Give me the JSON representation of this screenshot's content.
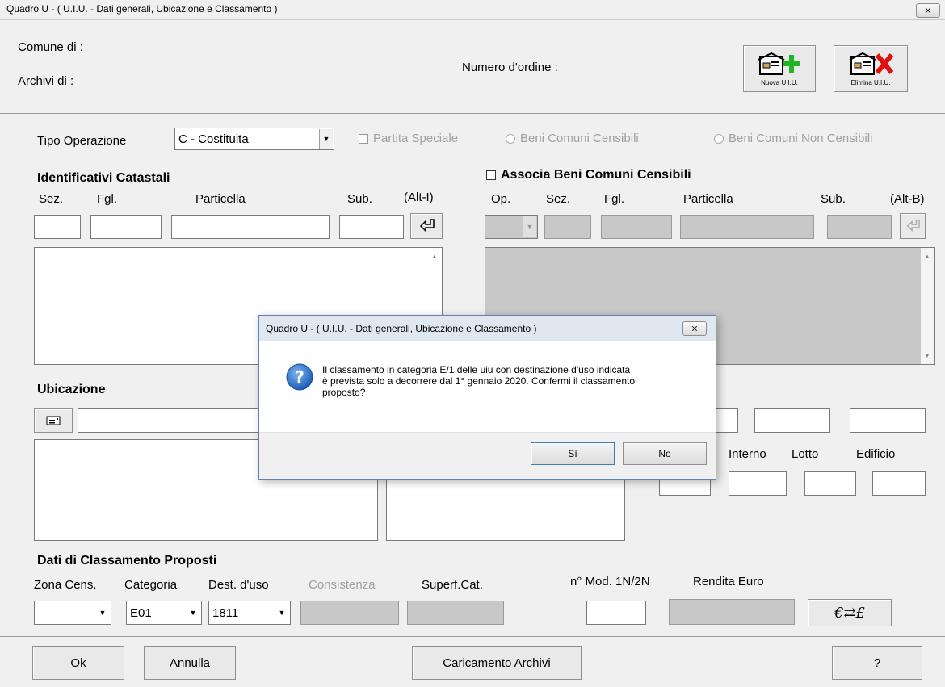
{
  "window": {
    "title": "Quadro U - ( U.I.U. - Dati generali, Ubicazione e Classamento )"
  },
  "header": {
    "comune_label": "Comune di  :",
    "archivi_label": "Archivi di   :",
    "numero_ordine_label": "Numero d'ordine :",
    "nuova_uiu": "Nuova U.I.U.",
    "elimina_uiu": "Elimina U.I.U."
  },
  "operazione": {
    "tipo_label": "Tipo Operazione",
    "tipo_value": "C - Costituita",
    "partita_speciale": "Partita Speciale",
    "beni_censibili": "Beni Comuni Censibili",
    "beni_non_censibili": "Beni Comuni Non Censibili"
  },
  "identificativi": {
    "title": "Identificativi Catastali",
    "sez": "Sez.",
    "fgl": "Fgl.",
    "particella": "Particella",
    "sub": "Sub.",
    "hotkey": "(Alt-I)"
  },
  "associa": {
    "title": "Associa Beni Comuni Censibili",
    "op": "Op.",
    "sez": "Sez.",
    "fgl": "Fgl.",
    "particella": "Particella",
    "sub": "Sub.",
    "hotkey": "(Alt-B)"
  },
  "ubicazione": {
    "title": "Ubicazione",
    "interno": "Interno",
    "lotto": "Lotto",
    "edificio": "Edificio"
  },
  "classamento": {
    "title": "Dati di Classamento Proposti",
    "zona_label": "Zona Cens.",
    "categoria_label": "Categoria",
    "dest_label": "Dest. d'uso",
    "consistenza_label": "Consistenza",
    "superf_label": "Superf.Cat.",
    "mod_label": "n° Mod. 1N/2N",
    "rendita_label": "Rendita  Euro",
    "categoria_value": "E01",
    "dest_value": "1811",
    "currency_symbol": "€⇄£"
  },
  "footer": {
    "ok": "Ok",
    "annulla": "Annulla",
    "caricamento": "Caricamento Archivi",
    "help": "?"
  },
  "dialog": {
    "title": "Quadro U - ( U.I.U. - Dati generali, Ubicazione e Classamento )",
    "message_line1": "Il classamento in categoria E/1 delle uiu con destinazione d'uso indicata",
    "message_line2": "è prevista solo a decorrere dal 1° gennaio 2020. Confermi il classamento",
    "message_line3": "proposto?",
    "yes": "Sì",
    "no": "No"
  }
}
